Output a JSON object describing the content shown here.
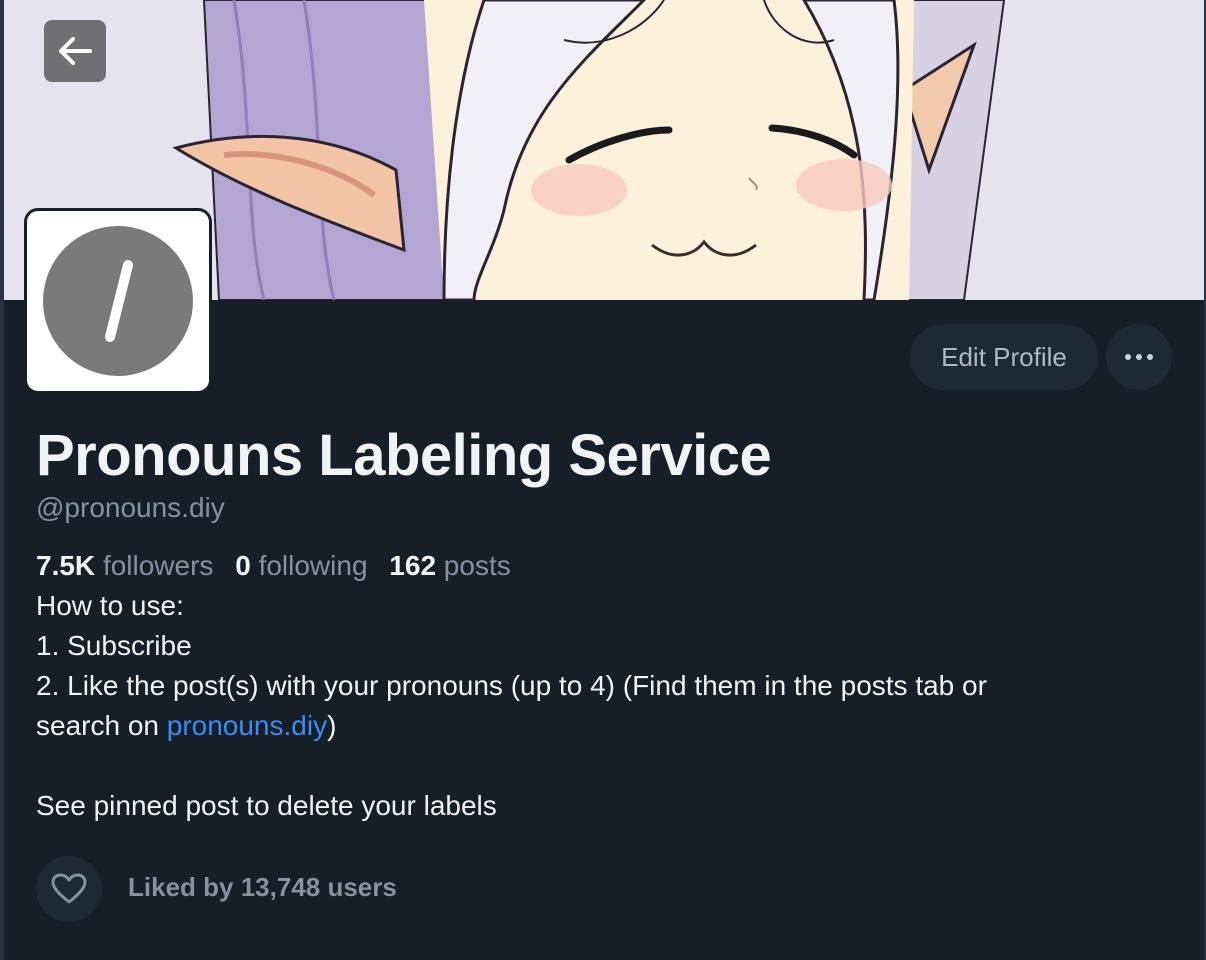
{
  "colors": {
    "background": "#161e27",
    "button_bg": "#1e2936",
    "text_primary": "#f1f3f5",
    "text_secondary": "#8492a2",
    "link": "#3b8cf5",
    "avatar_bg": "#7a7a7a"
  },
  "header": {
    "back_icon": "arrow-left-icon"
  },
  "avatar": {
    "glyph": "/"
  },
  "actions": {
    "edit_profile_label": "Edit Profile",
    "more_icon": "ellipsis-icon"
  },
  "profile": {
    "display_name": "Pronouns Labeling Service",
    "handle": "@pronouns.diy"
  },
  "stats": {
    "followers_count": "7.5K",
    "followers_label": "followers",
    "following_count": "0",
    "following_label": "following",
    "posts_count": "162",
    "posts_label": "posts"
  },
  "bio": {
    "line1": "How to use:",
    "line2": "1. Subscribe",
    "line3": "2. Like the post(s) with your pronouns (up to 4) (Find them in the posts tab or",
    "line4_prefix": "search on ",
    "line4_link": "pronouns.diy",
    "line4_suffix": ")",
    "line5": "See pinned post to delete your labels"
  },
  "likes": {
    "icon": "heart-icon",
    "text": "Liked by 13,748 users"
  }
}
